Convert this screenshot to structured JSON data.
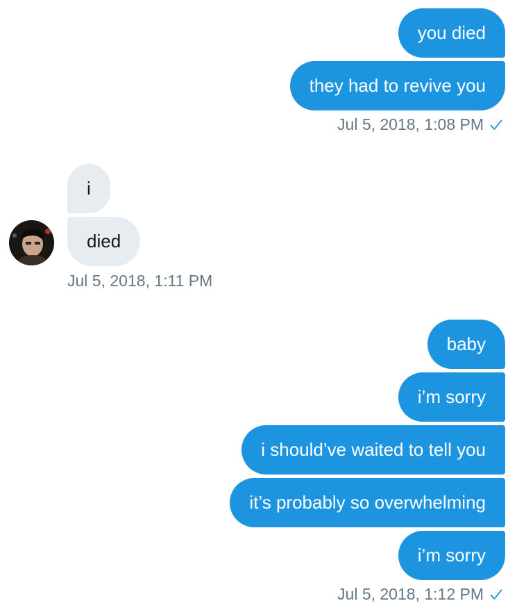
{
  "colors": {
    "sent_bubble": "#1c94e0",
    "received_bubble": "#e6ecf0",
    "timestamp_text": "#657786",
    "check_mark": "#1c94e0"
  },
  "groups": [
    {
      "direction": "sent",
      "messages": [
        {
          "text": "you died"
        },
        {
          "text": "they had to revive you"
        }
      ],
      "timestamp": "Jul 5, 2018, 1:08 PM",
      "read_icon": "check-icon"
    },
    {
      "direction": "received",
      "avatar_icon": "user-avatar",
      "messages": [
        {
          "text": "i"
        },
        {
          "text": "died"
        }
      ],
      "timestamp": "Jul 5, 2018, 1:11 PM"
    },
    {
      "direction": "sent",
      "messages": [
        {
          "text": "baby"
        },
        {
          "text": "i’m sorry"
        },
        {
          "text": "i should’ve waited to tell you"
        },
        {
          "text": "it’s probably so overwhelming"
        },
        {
          "text": "i’m sorry"
        }
      ],
      "timestamp": "Jul 5, 2018, 1:12 PM",
      "read_icon": "check-icon"
    }
  ]
}
